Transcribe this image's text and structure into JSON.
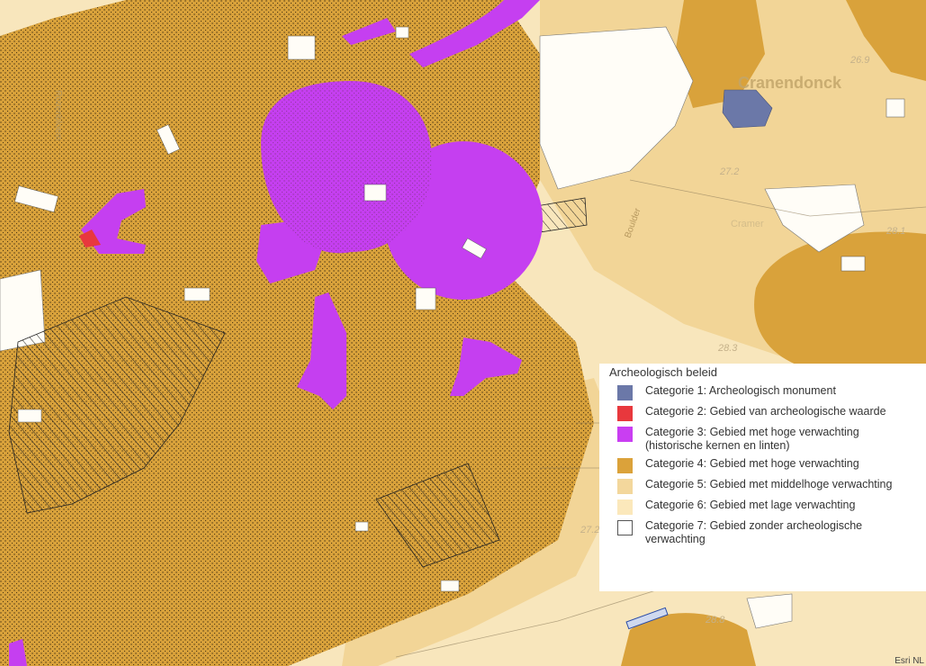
{
  "map": {
    "place_name": "Cranendonck",
    "street_labels": {
      "left": "Rozenbloem",
      "top_right_street": "Boulder",
      "lower": "Cramer"
    },
    "elevation_labels": [
      "26.9",
      "27.2",
      "28.1",
      "28.3",
      "27.2",
      "28.8"
    ],
    "attribution": "Esri NL"
  },
  "legend": {
    "title": "Archeologisch beleid",
    "items": [
      {
        "label": "Categorie 1: Archeologisch monument",
        "color": "#6b78a8"
      },
      {
        "label": "Categorie 2: Gebied van archeologische waarde",
        "color": "#e8383d"
      },
      {
        "label": "Categorie 3: Gebied met hoge verwachting (historische kernen en linten)",
        "color": "#c93ef2"
      },
      {
        "label": "Categorie 4: Gebied met hoge verwachting",
        "color": "#dba23a"
      },
      {
        "label": "Categorie 5: Gebied met middelhoge verwachting",
        "color": "#f3d79c"
      },
      {
        "label": "Categorie 6: Gebied met lage verwachting",
        "color": "#fbe8bb"
      },
      {
        "label": "Categorie 7: Gebied zonder archeologische verwachting",
        "color": "#ffffff"
      }
    ]
  }
}
